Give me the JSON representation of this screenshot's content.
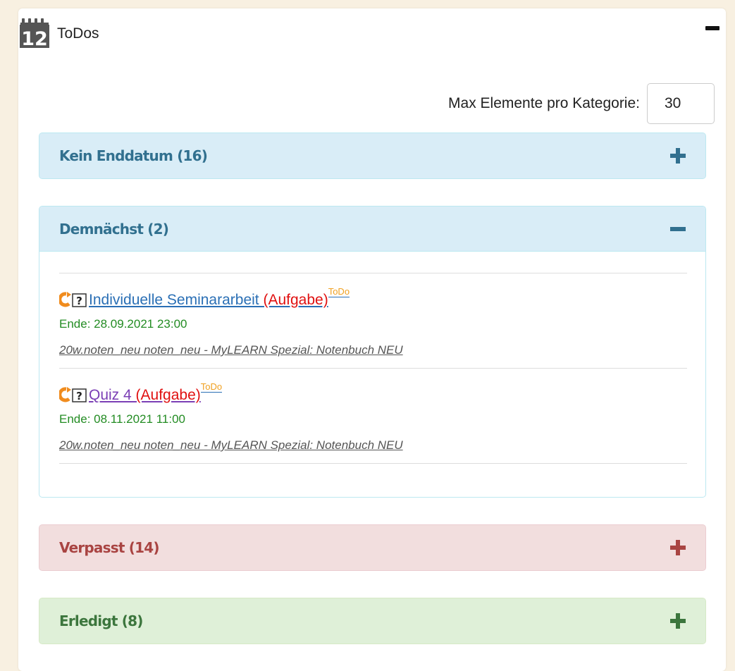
{
  "header": {
    "title": "ToDos",
    "icon_day": "12"
  },
  "max_elements": {
    "label": "Max Elemente pro Kategorie:",
    "value": "30"
  },
  "panels": {
    "no_end": {
      "title": "Kein Enddatum (16)"
    },
    "upcoming": {
      "title": "Demnächst (2)"
    },
    "missed": {
      "title": "Verpasst (14)"
    },
    "done": {
      "title": "Erledigt (8)"
    }
  },
  "items": [
    {
      "name": "Individuelle Seminararbeit ",
      "type": "(Aufgabe)",
      "badge": "ToDo",
      "end": "Ende: 28.09.2021 23:00",
      "course": "20w.noten_neu noten_neu - MyLEARN Spezial: Notenbuch NEU"
    },
    {
      "name": "Quiz 4 ",
      "type": "(Aufgabe)",
      "badge": "ToDo",
      "end": "Ende: 08.11.2021 11:00",
      "course": "20w.noten_neu noten_neu - MyLEARN Spezial: Notenbuch NEU"
    }
  ],
  "colors": {
    "info": "#d9edf7",
    "info_text": "#31708f",
    "danger": "#f2dede",
    "danger_text": "#a94442",
    "success": "#dff0d8",
    "success_text": "#3c763d",
    "end_date": "#238c23",
    "badge": "#f0a020"
  }
}
